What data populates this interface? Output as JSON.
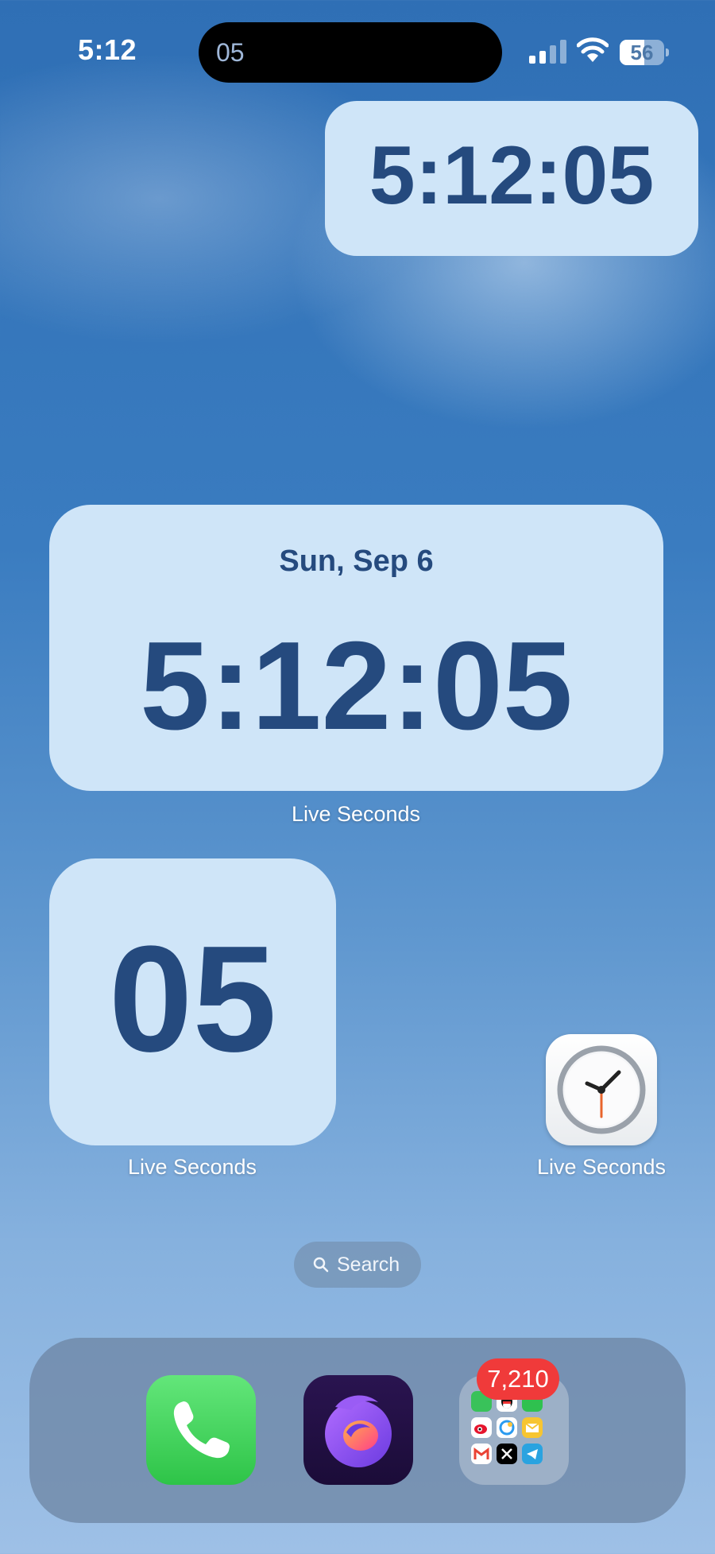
{
  "status_bar": {
    "time": "5:12",
    "island_seconds": "05",
    "battery_level": "56",
    "icons": [
      "cellular-signal-icon",
      "wifi-icon",
      "battery-icon"
    ]
  },
  "widgets": {
    "small_time": {
      "time": "5:12:05"
    },
    "large_time": {
      "date": "Sun, Sep 6",
      "time": "5:12:05",
      "label": "Live Seconds"
    },
    "seconds": {
      "seconds": "05",
      "label": "Live Seconds"
    }
  },
  "apps": {
    "clock": {
      "label": "Live Seconds",
      "icon": "clock-icon"
    }
  },
  "search": {
    "label": "Search"
  },
  "dock": {
    "apps": [
      {
        "name": "Phone",
        "icon": "phone-icon"
      },
      {
        "name": "Firefox",
        "icon": "firefox-icon"
      },
      {
        "name": "Folder",
        "icon": "folder-icon",
        "badge": "7,210"
      }
    ]
  },
  "colors": {
    "widget_bg": "#cfe5f8",
    "widget_text": "#254a7e",
    "badge": "#f03a3a"
  }
}
